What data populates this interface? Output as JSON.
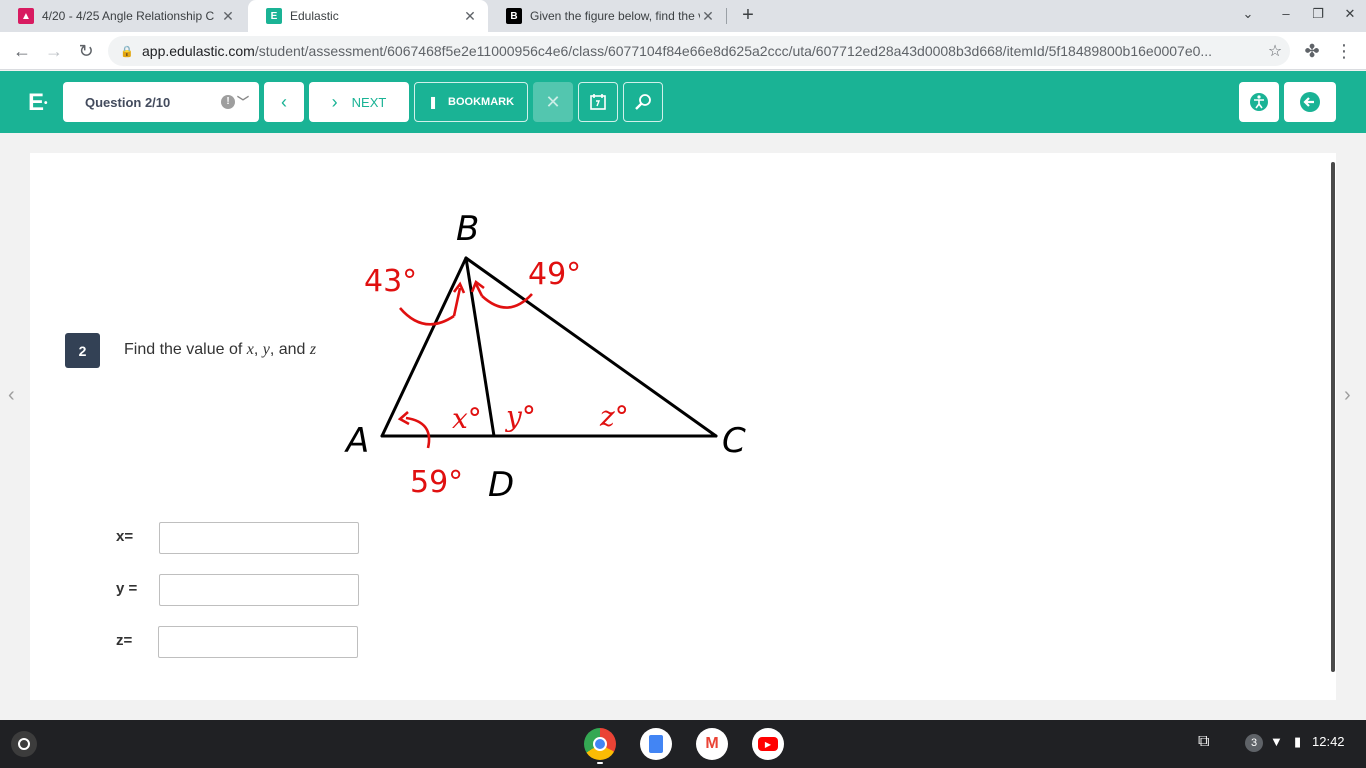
{
  "browser": {
    "tabs": [
      {
        "title": "4/20 - 4/25 Angle Relationship C",
        "favicon": "classroom-icon",
        "color": "#d81b60"
      },
      {
        "title": "Edulastic",
        "favicon": "edulastic-icon",
        "color": "#1ab395"
      },
      {
        "title": "Given the figure below, find the v",
        "favicon": "brainly-icon",
        "color": "#000000"
      }
    ],
    "url_host": "app.edulastic.com",
    "url_path": "/student/assessment/6067468f5e2e11000956c4e6/class/6077104f84e66e8d625a2ccc/uta/607712ed28a43d0008b3d668/itemId/5f18489800b16e0007e0..."
  },
  "header": {
    "logo": "E",
    "question_select": "Question 2/10",
    "next_label": "NEXT",
    "bookmark_label": "BOOKMARK",
    "accent": "#1ab395"
  },
  "question": {
    "number": "2",
    "text_prefix": "Find the value of ",
    "var_x": "x",
    "sep1": ", ",
    "var_y": "y",
    "sep2": ", and ",
    "var_z": "z"
  },
  "figure": {
    "point_labels": {
      "A": "A",
      "B": "B",
      "C": "C",
      "D": "D"
    },
    "angle_labels": {
      "abd": "43°",
      "dbc": "49°",
      "bad": "59°",
      "x": "x°",
      "y": "y°",
      "z": "z°"
    }
  },
  "answers": [
    {
      "label": "x=",
      "value": ""
    },
    {
      "label": "y =",
      "value": ""
    },
    {
      "label": "z=",
      "value": ""
    }
  ],
  "shelf": {
    "apps": [
      "chrome-icon",
      "docs-icon",
      "gmail-icon",
      "youtube-icon"
    ],
    "notifications": "3",
    "time": "12:42"
  }
}
